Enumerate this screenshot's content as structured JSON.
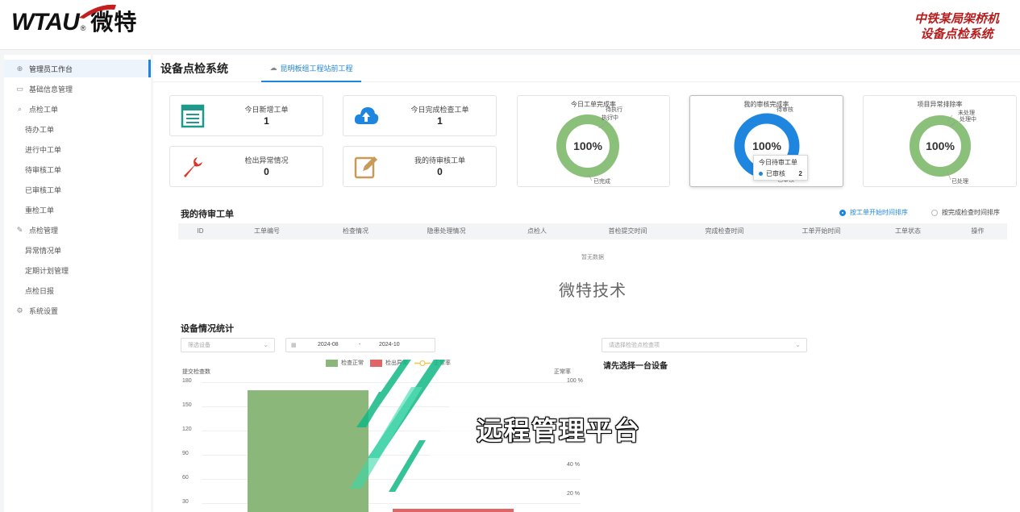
{
  "header": {
    "logo_text": "WTAU",
    "logo_cn": "微特",
    "system_name_line1": "中铁某局架桥机",
    "system_name_line2": "设备点检系统"
  },
  "sidebar": {
    "items": [
      {
        "label": "管理员工作台",
        "icon": "dashboard-icon"
      },
      {
        "label": "基础信息管理",
        "icon": "folder-icon"
      },
      {
        "label": "点检工单",
        "icon": "search-icon"
      },
      {
        "label": "待办工单"
      },
      {
        "label": "进行中工单"
      },
      {
        "label": "待审核工单"
      },
      {
        "label": "已审核工单"
      },
      {
        "label": "重检工单"
      },
      {
        "label": "点检管理",
        "icon": "edit-icon"
      },
      {
        "label": "异常情况单"
      },
      {
        "label": "定期计划管理"
      },
      {
        "label": "点检日报"
      },
      {
        "label": "系统设置",
        "icon": "gear-icon"
      }
    ]
  },
  "page": {
    "title": "设备点检系统",
    "project_tab": "昆明板组工程站前工程"
  },
  "stats": [
    {
      "label": "今日新增工单",
      "value": "1"
    },
    {
      "label": "今日完成检查工单",
      "value": "1"
    },
    {
      "label": "检出异常情况",
      "value": "0"
    },
    {
      "label": "我的待审核工单",
      "value": "0"
    }
  ],
  "donuts": [
    {
      "title": "今日工单完成率",
      "percent": "100%",
      "color": "#8bc07a",
      "labels": [
        "待执行",
        "执行中",
        "已完成"
      ]
    },
    {
      "title": "我的审核完成率",
      "percent": "100%",
      "color": "#1f86e0",
      "labels": [
        "待审核",
        "已审核"
      ]
    },
    {
      "title": "项目异常排除率",
      "percent": "100%",
      "color": "#8bc07a",
      "labels": [
        "未处理",
        "处理中",
        "已处理"
      ]
    }
  ],
  "tooltip": {
    "title": "今日待审工单",
    "series": "已审核",
    "value": "2"
  },
  "pending": {
    "title": "我的待审工单",
    "sort_options": [
      "按工单开始时间排序",
      "按完成检查时间排序"
    ],
    "columns": [
      "ID",
      "工单编号",
      "检查情况",
      "隐患处理情况",
      "点检人",
      "首检提交时间",
      "完成检查时间",
      "工单开始时间",
      "工单状态",
      "操作"
    ],
    "empty_text": "暂无数据",
    "watermark": "微特技术"
  },
  "equipment": {
    "title": "设备情况统计",
    "device_placeholder": "筛选设备",
    "date_start": "2024-08",
    "date_sep": "-",
    "date_end": "2024-10",
    "item_placeholder": "请选择检验点检查项",
    "select_prompt": "请先选择一台设备"
  },
  "chart_data": {
    "type": "bar",
    "legend": [
      "检查正常",
      "检出异常",
      "正常率"
    ],
    "colors": {
      "normal": "#8bb77a",
      "abnormal": "#e06666",
      "rate": "#f3c64a"
    },
    "ylabel_left": "提交检查数",
    "ylabel_right": "正常率",
    "left_ticks": [
      180,
      150,
      120,
      90,
      60,
      30
    ],
    "right_ticks": [
      "100 %",
      "40 %",
      "20 %"
    ],
    "ylim": [
      0,
      180
    ],
    "series": [
      {
        "name": "检查正常",
        "values": [
          170
        ]
      },
      {
        "name": "检出异常",
        "values": [
          0
        ]
      }
    ]
  },
  "overlay": {
    "subtitle": "远程管理平台"
  }
}
